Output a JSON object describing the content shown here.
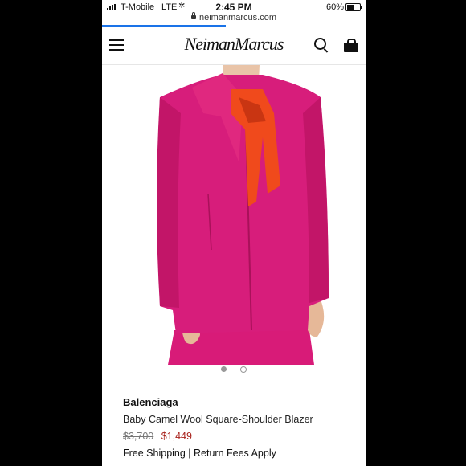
{
  "status_bar": {
    "carrier": "T-Mobile",
    "network": "LTE",
    "time": "2:45 PM",
    "battery": "60%"
  },
  "browser": {
    "url": "neimanmarcus.com",
    "load_progress": 0.47
  },
  "header": {
    "logo": "NeimanMarcus"
  },
  "carousel": {
    "total": 2,
    "current": 1
  },
  "product": {
    "brand": "Balenciaga",
    "name": "Baby Camel Wool Square-Shoulder Blazer",
    "original_price": "$3,700",
    "sale_price": "$1,449",
    "shipping": "Free Shipping | Return Fees Apply"
  },
  "colors": {
    "blazer": "#d91e7a",
    "scarf": "#f04a1c",
    "sale_price": "#a8201a",
    "progress": "#1a73e8"
  }
}
